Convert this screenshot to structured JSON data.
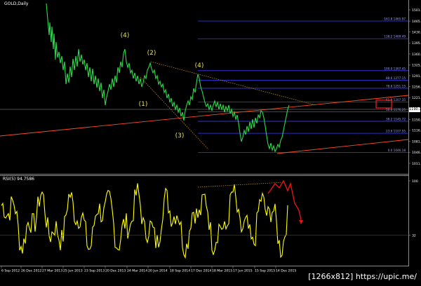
{
  "chart": {
    "symbol_label": "GOLD,Daily",
    "rsi_label": "RSI(5) 94.7586",
    "watermark": "[1266x812] https://upic.me/",
    "current_price_tag": "1190.11"
  },
  "price_axis": {
    "ticks": [
      "1501.80",
      "1465.77",
      "1430.80",
      "1395.80",
      "1360.80",
      "1325.32",
      "1291.45",
      "1256.45",
      "1221.45",
      "1186.11",
      "1150.84",
      "1116.87",
      "1081.31",
      "1046.84",
      "1011.52"
    ]
  },
  "rsi_axis": {
    "ticks": [
      "100",
      "32"
    ],
    "overbought": 100,
    "level_low": 32
  },
  "time_axis": {
    "ticks": [
      "6 Sep 2012",
      "26 Dec 2012",
      "27 Mar 2013",
      "25 Jun 2013",
      "23 Sep 2013",
      "20 Dec 2013",
      "24 Mar 2014",
      "20 Jun 2014",
      "18 Sep 2014",
      "17 Dec 2014",
      "18 Mar 2015",
      "17 Jun 2015",
      "15 Sep 2015",
      "14 Dec 2015"
    ]
  },
  "fib_levels": [
    {
      "label": "161.8  1465.97",
      "price": 1465.97
    },
    {
      "label": "138.2  1409.49",
      "price": 1409.49
    },
    {
      "label": "100.0  1307.45",
      "price": 1307.45
    },
    {
      "label": "88.6  1277.15",
      "price": 1277.15
    },
    {
      "label": "78.6  1251.15",
      "price": 1251.15
    },
    {
      "label": "61.8  1207.35",
      "price": 1207.35
    },
    {
      "label": "50.0  1176.25",
      "price": 1176.25
    },
    {
      "label": "38.2  1145.72",
      "price": 1145.72
    },
    {
      "label": "23.6  1107.55",
      "price": 1107.55
    },
    {
      "label": "0.0  1046.18",
      "price": 1046.18
    }
  ],
  "wave_labels": [
    {
      "text": "(4)",
      "color": "#e8e05a"
    },
    {
      "text": "(2)",
      "color": "#e8e05a"
    },
    {
      "text": "(4)",
      "color": "#e8e05a"
    },
    {
      "text": "(1)",
      "color": "#e8e05a"
    },
    {
      "text": "(3)",
      "color": "#e8e05a"
    }
  ],
  "colors": {
    "price_line": "#2bd94a",
    "rsi_line": "#ffff00",
    "fib_line": "#3a3aff",
    "trend_line": "#ff4a1f",
    "dotted_trend": "#b8861c",
    "highlight_box": "#ff1a1a",
    "annotation_arrow": "#e01515"
  }
}
